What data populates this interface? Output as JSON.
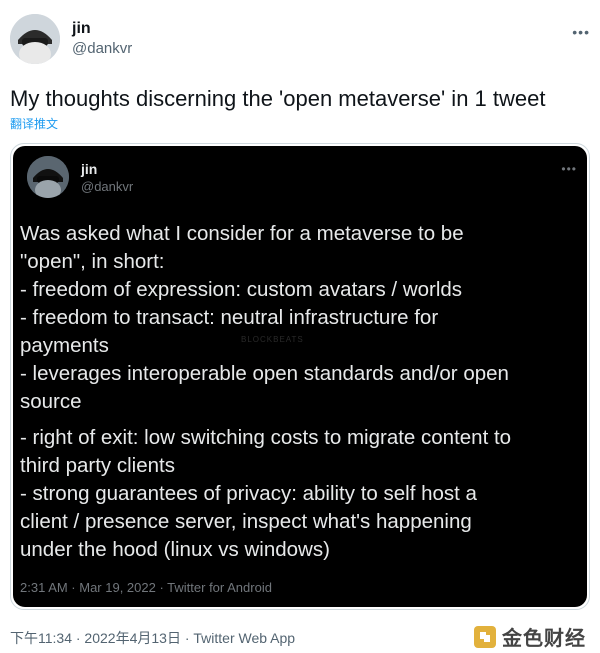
{
  "outer_tweet": {
    "name": "jin",
    "handle": "@dankvr",
    "text": "My thoughts discerning the 'open metaverse' in 1 tweet",
    "translate_label": "翻译推文",
    "meta": "下午11:34 · 2022年4月13日 · Twitter Web App",
    "more_label": "•••"
  },
  "quoted_tweet": {
    "name": "jin",
    "handle": "@dankvr",
    "more_label": "•••",
    "lines_group1": [
      "Was asked what I consider for a metaverse to be",
      "\"open\", in short:",
      "- freedom of expression: custom avatars / worlds",
      "- freedom to transact: neutral infrastructure for",
      "payments",
      "- leverages interoperable open standards and/or open",
      "source"
    ],
    "lines_group2": [
      "- right of exit: low switching costs to migrate content to",
      "third party clients",
      "- strong guarantees of privacy: ability to self host a",
      "client / presence server, inspect what's happening",
      "under the hood (linux vs windows)"
    ],
    "watermark": "BLOCKBEATS",
    "meta": "2:31 AM · Mar 19, 2022 · Twitter for Android"
  },
  "brand": {
    "text": "金色财经",
    "color": "#e2b13c"
  },
  "colors": {
    "link": "#1d9bf0",
    "secondary": "#536471",
    "embedded_bg": "#000000"
  }
}
